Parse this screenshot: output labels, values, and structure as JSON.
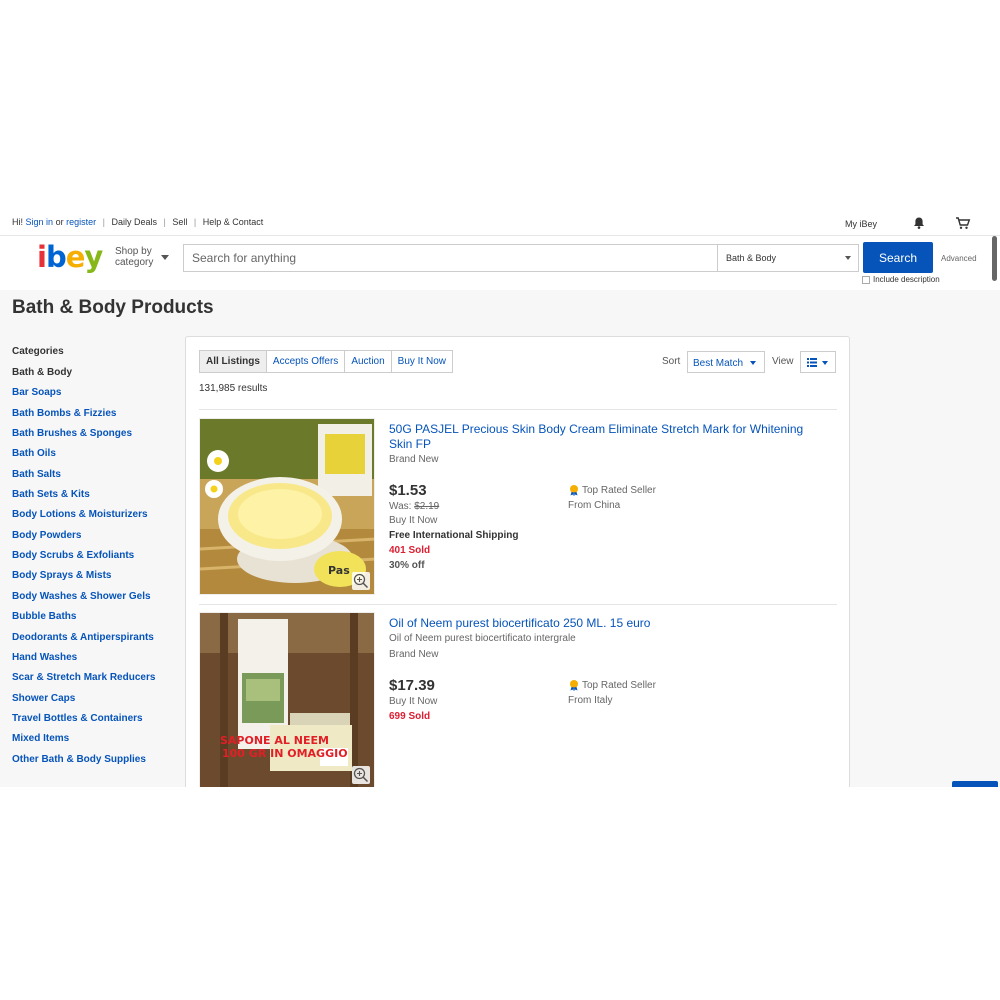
{
  "topbar": {
    "greeting": "Hi!",
    "sign_in": "Sign in",
    "or": "or",
    "register": "register",
    "links": [
      "Daily Deals",
      "Sell",
      "Help & Contact"
    ],
    "my_ibey": "My iBey"
  },
  "header": {
    "logo": [
      "i",
      "b",
      "e",
      "y"
    ],
    "shop_by_1": "Shop by",
    "shop_by_2": "category",
    "search_placeholder": "Search for anything",
    "category": "Bath & Body",
    "search_button": "Search",
    "advanced": "Advanced",
    "include_description": "Include description"
  },
  "page_title": "Bath & Body Products",
  "sidebar": {
    "heading": "Categories",
    "current": "Bath & Body",
    "items": [
      "Bar Soaps",
      "Bath Bombs & Fizzies",
      "Bath Brushes & Sponges",
      "Bath Oils",
      "Bath Salts",
      "Bath Sets & Kits",
      "Body Lotions & Moisturizers",
      "Body Powders",
      "Body Scrubs & Exfoliants",
      "Body Sprays & Mists",
      "Body Washes & Shower Gels",
      "Bubble Baths",
      "Deodorants & Antiperspirants",
      "Hand Washes",
      "Scar & Stretch Mark Reducers",
      "Shower Caps",
      "Travel Bottles & Containers",
      "Mixed Items",
      "Other Bath & Body Supplies"
    ]
  },
  "results": {
    "tabs": [
      "All Listings",
      "Accepts Offers",
      "Auction",
      "Buy It Now"
    ],
    "count": "131,985 results",
    "sort_label": "Sort",
    "sort_value": "Best Match",
    "view_label": "View"
  },
  "listings": [
    {
      "title": "50G PASJEL Precious Skin Body Cream Eliminate Stretch Mark for Whitening Skin FP",
      "condition": "Brand New",
      "price": "$1.53",
      "was_label": "Was:",
      "was_price": "$2.19",
      "format": "Buy It Now",
      "shipping": "Free International Shipping",
      "sold": "401 Sold",
      "discount": "30% off",
      "seller_badge": "Top Rated Seller",
      "location": "From China"
    },
    {
      "title": "Oil of Neem purest biocertificato 250 ML. 15 euro",
      "subtitle": "Oil of Neem purest biocertificato intergrale",
      "condition": "Brand New",
      "price": "$17.39",
      "format": "Buy It Now",
      "sold": "699 Sold",
      "seller_badge": "Top Rated Seller",
      "location": "From Italy",
      "image_text_1": "SAPONE AL NEEM",
      "image_text_2": "100 GR IN OMAGGIO"
    }
  ],
  "colors": {
    "link": "#0654ba",
    "sold": "#dd1e31",
    "logo": [
      "#e53238",
      "#0064d2",
      "#f5af02",
      "#86b817"
    ]
  }
}
